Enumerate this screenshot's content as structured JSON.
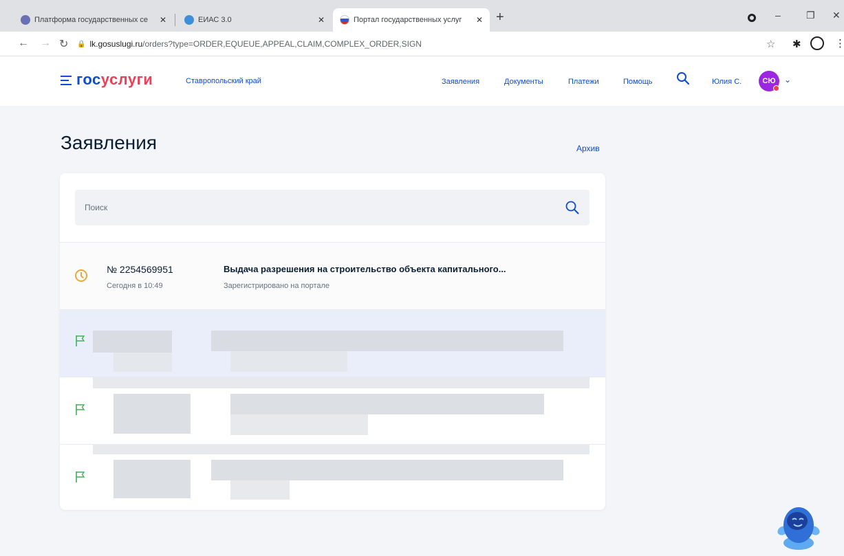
{
  "browser": {
    "tabs": [
      {
        "title": "Платформа государственных се"
      },
      {
        "title": "ЕИАС 3.0"
      },
      {
        "title": "Портал государственных услуг"
      }
    ],
    "url_host": "lk.gosuslugi.ru",
    "url_path": "/orders?type=ORDER,EQUEUE,APPEAL,CLAIM,COMPLEX_ORDER,SIGN"
  },
  "header": {
    "logo_part1": "гос",
    "logo_part2": "услуги",
    "region": "Ставропольский край",
    "nav": [
      "Заявления",
      "Документы",
      "Платежи",
      "Помощь"
    ],
    "user_name": "Юлия С.",
    "avatar_initials": "СЮ"
  },
  "main": {
    "title": "Заявления",
    "archive_link": "Архив",
    "search_placeholder": "Поиск",
    "orders": [
      {
        "number": "№ 2254569951",
        "date": "Сегодня в 10:49",
        "title": "Выдача разрешения на строительство объекта капитального...",
        "status": "Зарегистрировано на портале"
      }
    ]
  },
  "colors": {
    "brand_blue": "#0d4cd3",
    "brand_red": "#ee3f58",
    "pending_orange": "#e8a93b",
    "flag_green": "#43b05c"
  }
}
